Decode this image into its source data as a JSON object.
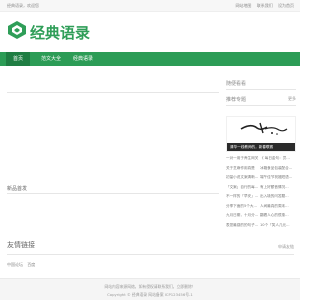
{
  "topbar": {
    "welcome": "经典语录，欢迎您",
    "links": [
      "网站地图",
      "联系我们",
      "设为首页"
    ]
  },
  "logo": {
    "name": "经典语录"
  },
  "nav": {
    "items": [
      "首页",
      "范文大全",
      "经典语录"
    ]
  },
  "main": {
    "latest_title": "新品首发"
  },
  "sidebar": {
    "top_title": "随便看看",
    "rec_title": "推荐专题",
    "rec_more": "更多",
    "banner_caption": "清华一线教师的，新春联赛",
    "list": [
      [
        "一对一用于养生网关",
        "《 每日金句：员..."
      ],
      [
        "关于芝麻作用真是",
        "冰箱食品包装配合..."
      ],
      [
        "初量小说文案清晰...",
        "端午佳节祝福短语..."
      ],
      [
        "「文案」自行的每...",
        "有上好颤音情况..."
      ],
      [
        "不一样的「早安」...",
        "出入境的问答题..."
      ],
      [
        "分享下面的5个大...",
        "人间最真的周末..."
      ],
      [
        "九月日期，十月分...",
        "翻看人心的很惠..."
      ],
      [
        "表您最感的的句子...",
        "10个「笑人几元..."
      ]
    ]
  },
  "friend": {
    "title": "友情链接",
    "more": "申请友链",
    "links": [
      "中国论坛",
      "百度"
    ]
  },
  "footer": {
    "line1": "网站内容来源网络，如有侵权请联系我们，立即删除！",
    "line2": "Copyright © 经典语录 网站备案 ICP123456号-1"
  }
}
